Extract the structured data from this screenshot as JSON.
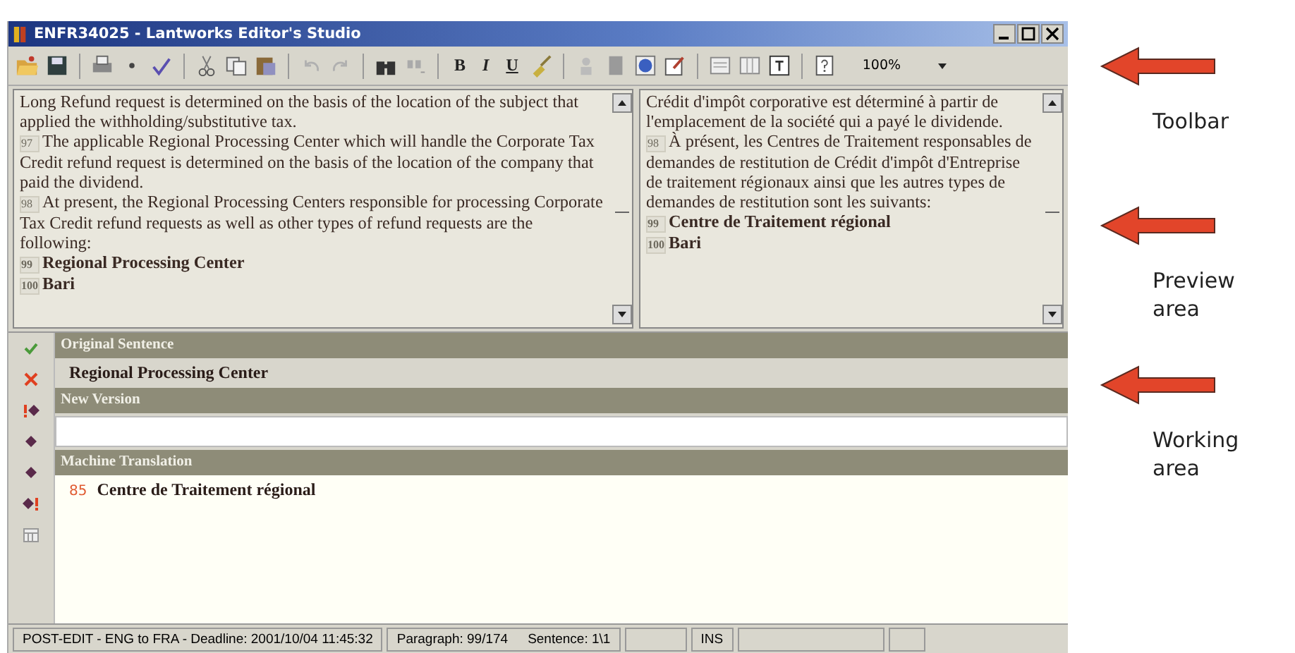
{
  "window": {
    "title": "ENFR34025 - Lantworks Editor's Studio"
  },
  "toolbar": {
    "format_buttons": [
      "B",
      "I",
      "U"
    ],
    "zoom": "100%"
  },
  "preview": {
    "source": [
      {
        "text": "Long Refund request is determined on the basis of the location of the subject that applied the withholding/substitutive tax.",
        "bold": false
      },
      {
        "number": "97",
        "text": "The applicable Regional Processing Center which will handle the Corporate Tax Credit refund request is determined on the basis of the location of the company that paid the dividend.",
        "bold": false
      },
      {
        "number": "98",
        "text": "At present, the Regional Processing Centers responsible for processing Corporate Tax Credit refund requests as well as other types of refund requests are the following:",
        "bold": false
      },
      {
        "number": "99",
        "text": "Regional Processing Center",
        "bold": true
      },
      {
        "number": "100",
        "text": "Bari",
        "bold": true
      }
    ],
    "target": [
      {
        "text": "Crédit d'impôt corporative est déterminé à partir de l'emplacement de la société qui a payé le dividende.",
        "bold": false
      },
      {
        "number": "98",
        "text": "À présent, les Centres de Traitement responsables de demandes de restitution de Crédit d'impôt d'Entreprise de traitement régionaux ainsi que les autres types de demandes de restitution sont les suivants:",
        "bold": false
      },
      {
        "number": "99",
        "text": "Centre de Traitement régional",
        "bold": true
      },
      {
        "number": "100",
        "text": "Bari",
        "bold": true
      }
    ]
  },
  "working": {
    "original_header": "Original Sentence",
    "original_text": "Regional Processing Center",
    "new_header": "New Version",
    "machine_header": "Machine Translation",
    "machine_score": "85",
    "machine_text": "Centre de Traitement régional"
  },
  "status_bar": {
    "mode": "POST-EDIT - ENG to FRA - Deadline: 2001/10/04 11:45:32",
    "paragraph": "Paragraph: 99/174",
    "sentence": "Sentence: 1\\1",
    "insert": "INS"
  },
  "annotations": [
    {
      "label": "Toolbar"
    },
    {
      "label": "Preview area"
    },
    {
      "label": "Working area"
    }
  ]
}
